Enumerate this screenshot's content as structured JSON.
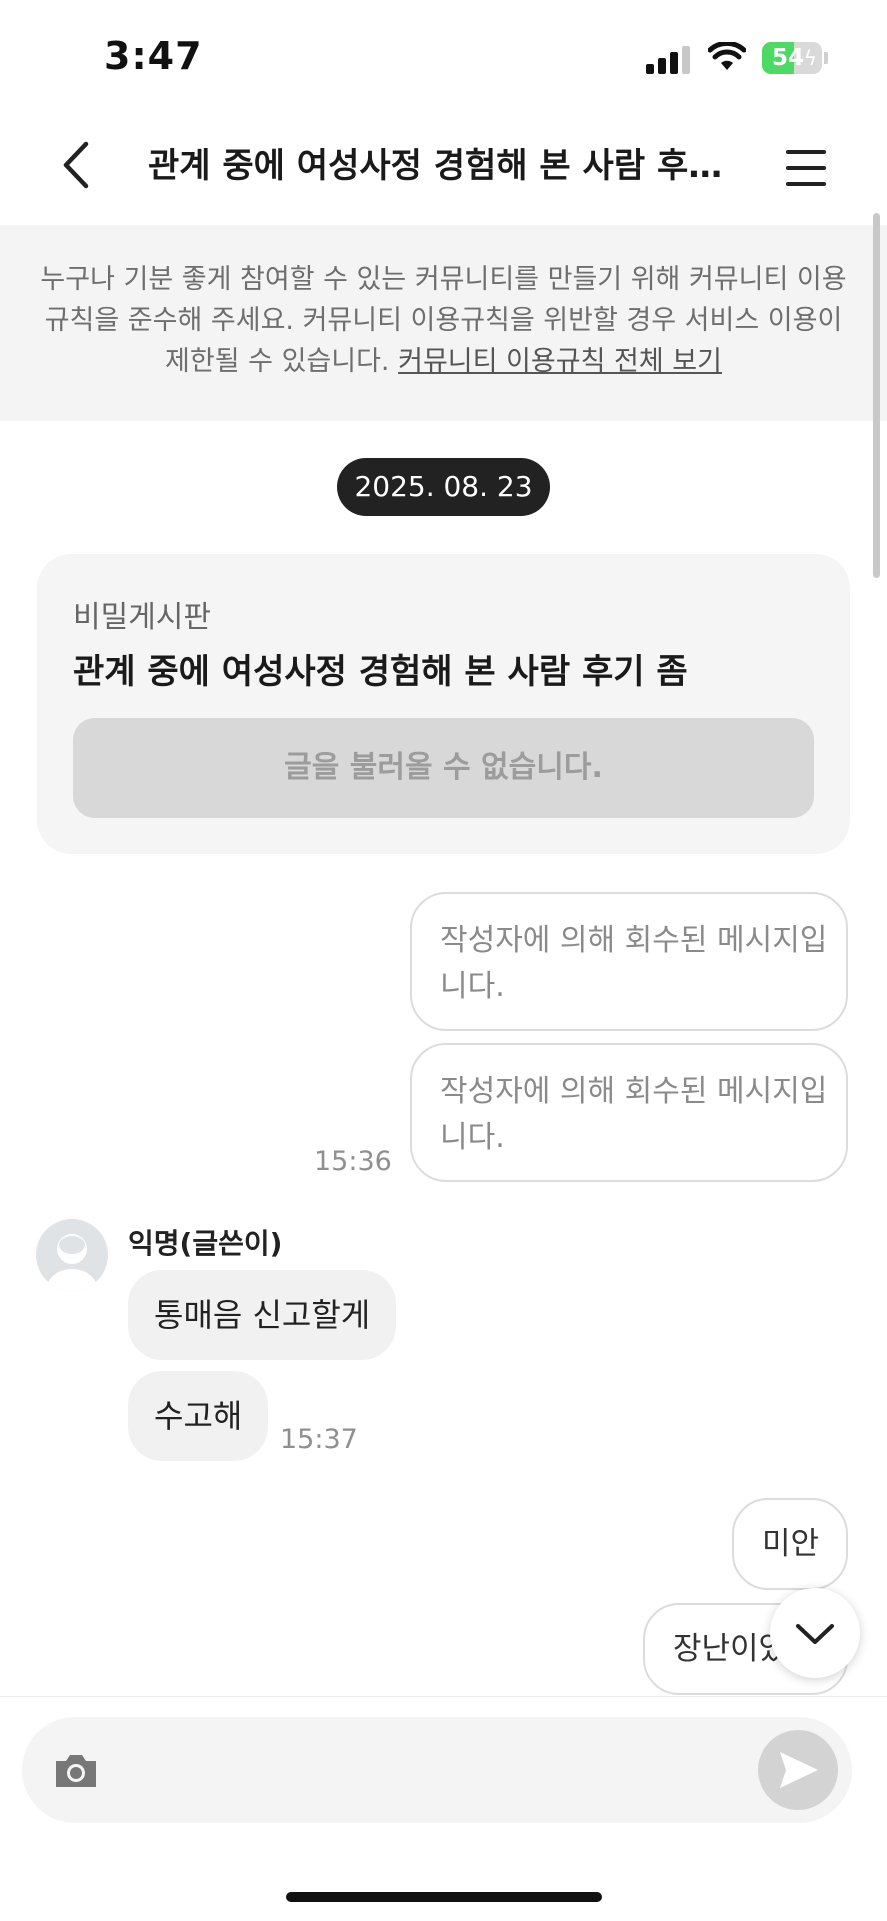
{
  "status_bar": {
    "time": "3:47",
    "battery": "54",
    "battery_level": 0.54
  },
  "header": {
    "title": "관계 중에 여성사정 경험해 본 사람 후기 좀"
  },
  "notice": {
    "text": "누구나 기분 좋게 참여할 수 있는 커뮤니티를 만들기 위해 커뮤니티 이용규칙을 준수해 주세요. 커뮤니티 이용규칙을 위반할 경우 서비스 이용이 제한될 수 있습니다.",
    "link": "커뮤니티 이용규칙 전체 보기"
  },
  "date_pill": "2025. 08. 23",
  "post_card": {
    "board": "비밀게시판",
    "title": "관계 중에 여성사정 경험해 본 사람 후기 좀",
    "error": "글을 불러올 수 없습니다."
  },
  "messages": {
    "retracted_1": "작성자에 의해 회수된 메시지입니다.",
    "retracted_2": "작성자에 의해 회수된 메시지입니다.",
    "sent_time_1": "15:36",
    "sender": "익명(글쓴이)",
    "in_1": "통매음 신고할게",
    "in_2": "수고해",
    "in_time": "15:37",
    "out_1": "미안",
    "out_2": "장난이었"
  },
  "icons": {
    "back": "chevron-left-icon",
    "menu": "hamburger-icon",
    "scroll_down": "chevron-down-icon",
    "camera": "camera-icon",
    "send": "send-icon"
  },
  "colors": {
    "dark_pill": "#222222",
    "bubble_in": "#f1f1f1",
    "notice_bg": "#f4f4f4",
    "battery": "#4cd964"
  }
}
